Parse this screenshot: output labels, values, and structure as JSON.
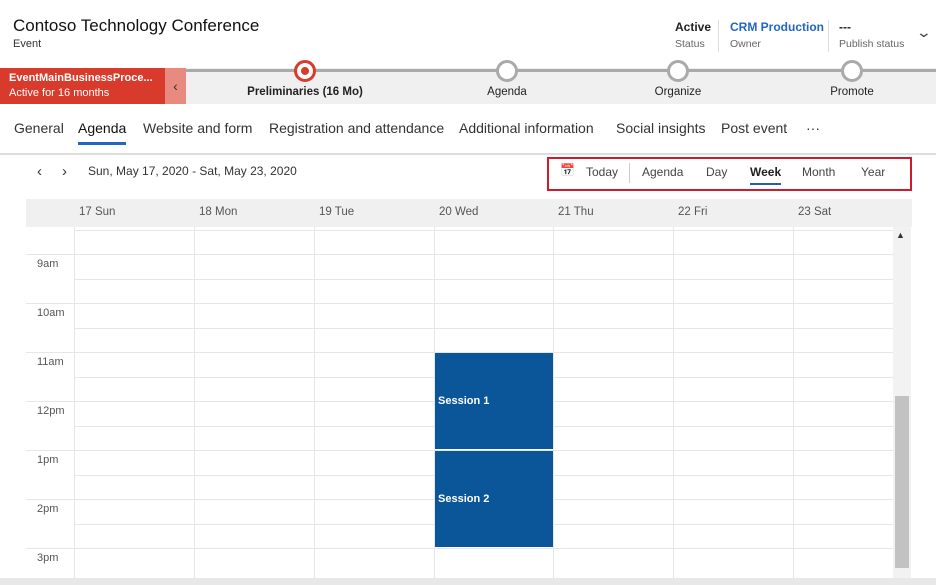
{
  "header": {
    "title": "Contoso Technology Conference",
    "entity": "Event",
    "fields": [
      {
        "value": "Active",
        "label": "Status"
      },
      {
        "value": "CRM Production",
        "label": "Owner",
        "link": true
      },
      {
        "value": "---",
        "label": "Publish status"
      }
    ]
  },
  "bpf": {
    "name": "EventMainBusinessProce...",
    "duration": "Active for 16 months",
    "stages": [
      {
        "label": "Preliminaries  (16 Mo)",
        "active": true
      },
      {
        "label": "Agenda"
      },
      {
        "label": "Organize"
      },
      {
        "label": "Promote"
      }
    ]
  },
  "tabs": [
    "General",
    "Agenda",
    "Website and form",
    "Registration and attendance",
    "Additional information",
    "Social insights",
    "Post event",
    "···"
  ],
  "selected_tab": "Agenda",
  "calendar": {
    "date_range": "Sun, May 17, 2020 - Sat, May 23, 2020",
    "today": "Today",
    "views": [
      "Agenda",
      "Day",
      "Week",
      "Month",
      "Year"
    ],
    "selected_view": "Week",
    "days": [
      "17 Sun",
      "18 Mon",
      "19 Tue",
      "20 Wed",
      "21 Thu",
      "22 Fri",
      "23 Sat"
    ],
    "times": [
      "9am",
      "10am",
      "11am",
      "12pm",
      "1pm",
      "2pm",
      "3pm"
    ],
    "sessions": [
      {
        "title": "Session 1",
        "day": "20 Wed",
        "start": "11am",
        "end": "1pm"
      },
      {
        "title": "Session 2",
        "day": "20 Wed",
        "start": "1pm",
        "end": "3pm"
      }
    ]
  },
  "colors": {
    "bpf_red": "#d83b2b",
    "session": "#0a5699",
    "link": "#2266c4",
    "highlight_box": "#d0192d"
  }
}
